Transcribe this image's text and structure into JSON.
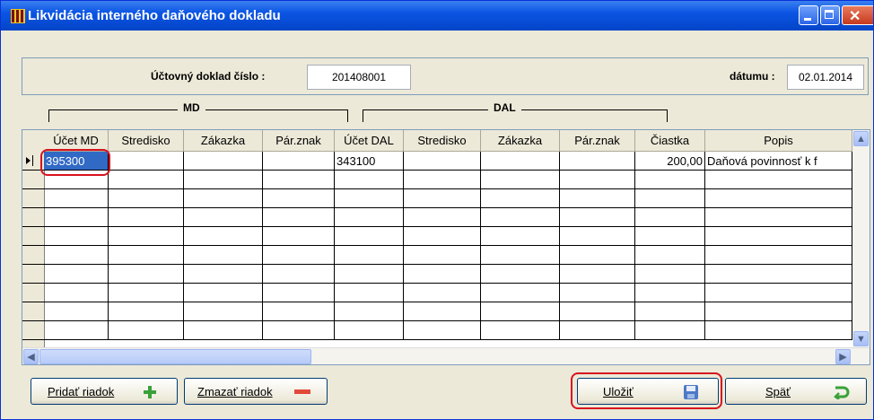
{
  "window": {
    "title": "Likvidácia interného daňového dokladu"
  },
  "header": {
    "doc_label": "Účtovný doklad číslo :",
    "doc_value": "201408001",
    "date_label": "dátumu :",
    "date_value": "02.01.2014"
  },
  "groups": {
    "md": "MD",
    "dal": "DAL"
  },
  "grid": {
    "columns": [
      "Účet MD",
      "Stredisko",
      "Zákazka",
      "Pár.znak",
      "Účet DAL",
      "Stredisko",
      "Zákazka",
      "Pár.znak",
      "Čiastka",
      "Popis"
    ],
    "rows": [
      [
        "395300",
        "",
        "",
        "",
        "343100",
        "",
        "",
        "",
        "200,00",
        "Daňová povinnosť k f"
      ]
    ]
  },
  "buttons": {
    "add_row": "Pridať riadok",
    "delete_row": "Zmazať riadok",
    "save": "Uložiť",
    "back": "Späť"
  },
  "colors": {
    "title_bar": "#0b55e3",
    "highlight": "#d8121e",
    "selected_cell": "#316ac5"
  }
}
